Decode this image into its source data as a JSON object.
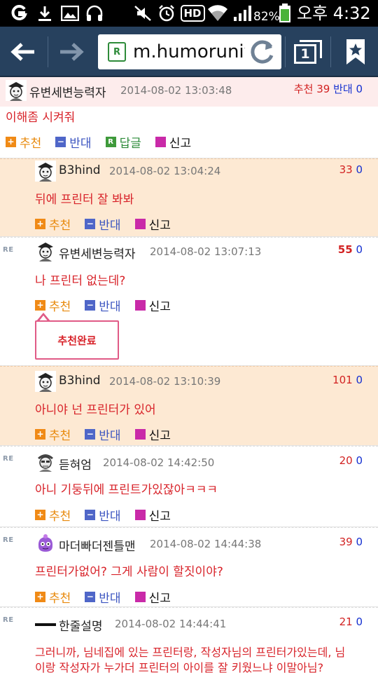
{
  "status_bar": {
    "battery_percent": "82%",
    "time": "오후 4:32",
    "hd_label": "HD"
  },
  "browser": {
    "url": "m.humoruniv",
    "tab_count": "1"
  },
  "comments": [
    {
      "nickname": "유변세변능력자",
      "date": "2014-08-02 13:03:48",
      "up_label": "추천",
      "up_count": "39",
      "down_label": "반대",
      "down_count": "0",
      "text": "이해좀 시켜줘",
      "actions": {
        "up": "추천",
        "down": "반대",
        "reply": "답글",
        "report": "신고"
      }
    },
    {
      "nickname": "B3hind",
      "date": "2014-08-02 13:04:24",
      "up_count": "33",
      "down_count": "0",
      "text": "뒤에 프린터 잘 봐봐",
      "actions": {
        "up": "추천",
        "down": "반대",
        "report": "신고"
      }
    },
    {
      "re": "RE",
      "nickname": "유변세변능력자",
      "date": "2014-08-02 13:07:13",
      "up_count": "55",
      "down_count": "0",
      "text": "나 프린터 없는데?",
      "actions": {
        "up": "추천",
        "down": "반대",
        "report": "신고"
      },
      "tooltip": "추천완료"
    },
    {
      "nickname": "B3hind",
      "date": "2014-08-02 13:10:39",
      "up_count": "101",
      "down_count": "0",
      "text": "아니야 넌 프린터가 있어",
      "actions": {
        "up": "추천",
        "down": "반대",
        "report": "신고"
      }
    },
    {
      "re": "RE",
      "nickname": "듣혀엄",
      "date": "2014-08-02 14:42:50",
      "up_count": "20",
      "down_count": "0",
      "text": "아니 기둥뒤에 프린트가있잖아ㅋㅋㅋ",
      "actions": {
        "up": "추천",
        "down": "반대",
        "report": "신고"
      }
    },
    {
      "re": "RE",
      "nickname": "마더빠더젠틀맨",
      "date": "2014-08-02 14:44:38",
      "up_count": "39",
      "down_count": "0",
      "text": "프린터가없어? 그게 사람이 할짓이야?",
      "actions": {
        "up": "추천",
        "down": "반대",
        "report": "신고"
      }
    },
    {
      "re": "RE",
      "nickname": "한줄설명",
      "date": "2014-08-02 14:44:41",
      "up_count": "21",
      "down_count": "0",
      "text_line1": "그러니까, 님네집에 있는 프린터랑, 작성자님의 프린터가있는데, 님",
      "text_line2": "이랑 작성자가 누가더 프린터의 아이를 잘 키웠느냐 이말아님?"
    }
  ],
  "colors": {
    "toolbar": "#27415e",
    "comment_text": "#d8232a",
    "up_count": "#d22222",
    "down_count": "#1530d0",
    "orange_row": "#fde9d3",
    "first_head": "#fdecec"
  }
}
